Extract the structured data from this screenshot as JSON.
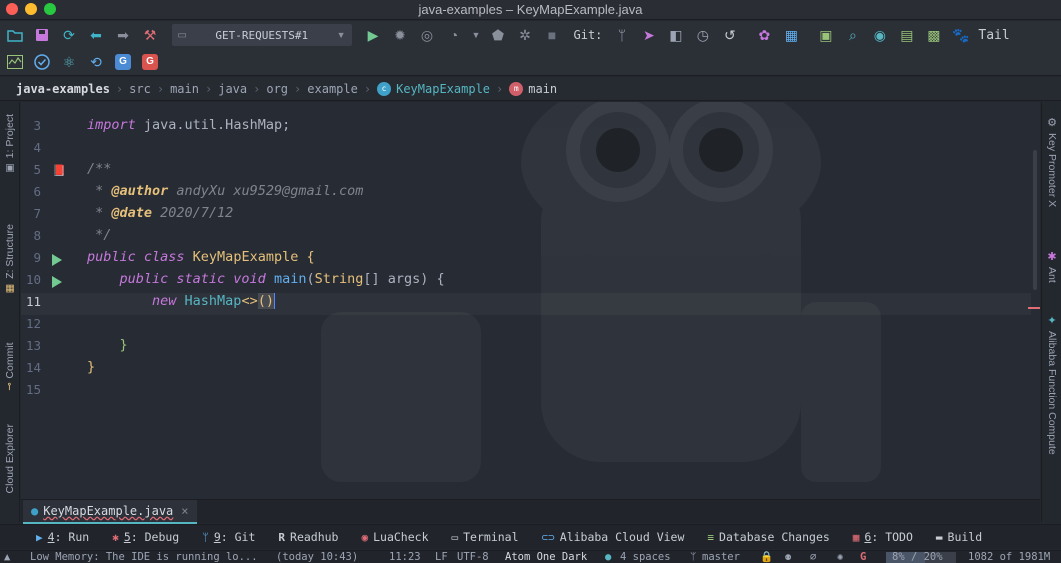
{
  "window": {
    "title": "java-examples – KeyMapExample.java"
  },
  "toolbar": {
    "run_config": "GET-REQUESTS#1",
    "git_label": "Git:",
    "tail_label": "Tail",
    "icons_row1_left": [
      "folder-icon",
      "save-icon",
      "sync-icon",
      "back-arrow-icon",
      "forward-arrow-icon",
      "build-hammer-icon"
    ],
    "icons_row1_right": [
      "run-icon",
      "debug-icon",
      "coverage-icon",
      "profile-icon",
      "dropdown-icon",
      "attach-icon",
      "run-anything-icon",
      "stop-icon"
    ],
    "icons_git": [
      "git-branch-icon",
      "git-push-icon",
      "git-compare-icon",
      "git-history-icon",
      "git-rollback-icon"
    ],
    "icons_tools": [
      "settings-icon",
      "structure-grid-icon",
      "terminal-icon",
      "search-icon",
      "record-icon",
      "translate-icon",
      "plugin-icon"
    ],
    "icons_row2": [
      "activity-icon",
      "check-icon",
      "atom-icon",
      "refresh-link-icon",
      "translate-g-icon",
      "translate-red-icon"
    ]
  },
  "breadcrumb": {
    "root": "java-examples",
    "items": [
      "src",
      "main",
      "java",
      "org",
      "example"
    ],
    "class_name": "KeyMapExample",
    "method_name": "main",
    "method_badge": "m"
  },
  "left_tabs": {
    "project": "1: Project",
    "structure": "Z: Structure",
    "commit": "Commit",
    "cloud": "Cloud Explorer"
  },
  "right_tabs": {
    "key_promoter": "Key Promoter X",
    "ant": "Ant",
    "alibaba": "Alibaba Function Compute"
  },
  "editor": {
    "line_numbers": [
      "3",
      "4",
      "5",
      "6",
      "7",
      "8",
      "9",
      "10",
      "11",
      "12",
      "13",
      "14",
      "15"
    ],
    "current_line": "11",
    "lines": {
      "l3_kw": "import",
      "l3_rest": " java.util.HashMap;",
      "l5": "/**",
      "l6_star": " * ",
      "l6_tag": "@author",
      "l6_val": " andyXu xu9529@gmail.com",
      "l7_star": " * ",
      "l7_tag": "@date",
      "l7_val": " 2020/7/12",
      "l8": " */",
      "l9_kw": "public class",
      "l9_cls": " KeyMapExample",
      "l9_end": " {",
      "l10_kw": "    public static void",
      "l10_fn": " main",
      "l10_p1": "(",
      "l10_type": "String",
      "l10_p2": "[] args) {",
      "l11_kw": "        new",
      "l11_cls": " HashMap",
      "l11_op": "<>",
      "l11_paren": "()",
      "l13": "    }",
      "l14": "}"
    }
  },
  "file_tab": {
    "name": "KeyMapExample.java",
    "close": "×"
  },
  "tool_windows": [
    {
      "num": "4",
      "label": ": Run",
      "icon": "▶"
    },
    {
      "num": "5",
      "label": ": Debug",
      "icon": "✱"
    },
    {
      "num": "9",
      "label": ": Git",
      "icon": "ᛘ"
    },
    {
      "num": "",
      "label": "Readhub",
      "icon": "R"
    },
    {
      "num": "",
      "label": "LuaCheck",
      "icon": "◉"
    },
    {
      "num": "",
      "label": "Terminal",
      "icon": "▭"
    },
    {
      "num": "",
      "label": "Alibaba Cloud View",
      "icon": "⊂⊃"
    },
    {
      "num": "",
      "label": "Database Changes",
      "icon": "≡"
    },
    {
      "num": "6",
      "label": ": TODO",
      "icon": "▦"
    },
    {
      "num": "",
      "label": "Build",
      "icon": "▬"
    }
  ],
  "status": {
    "message": "Low Memory: The IDE is running lo...",
    "time": "(today 10:43)",
    "position": "11:23",
    "line_sep": "LF",
    "encoding": "UTF-8",
    "theme": "Atom One Dark",
    "indent": "4 spaces",
    "branch": "master",
    "percent": "8% / 20%",
    "memory": "1082 of 1981M",
    "memory_fraction": 0.55
  }
}
